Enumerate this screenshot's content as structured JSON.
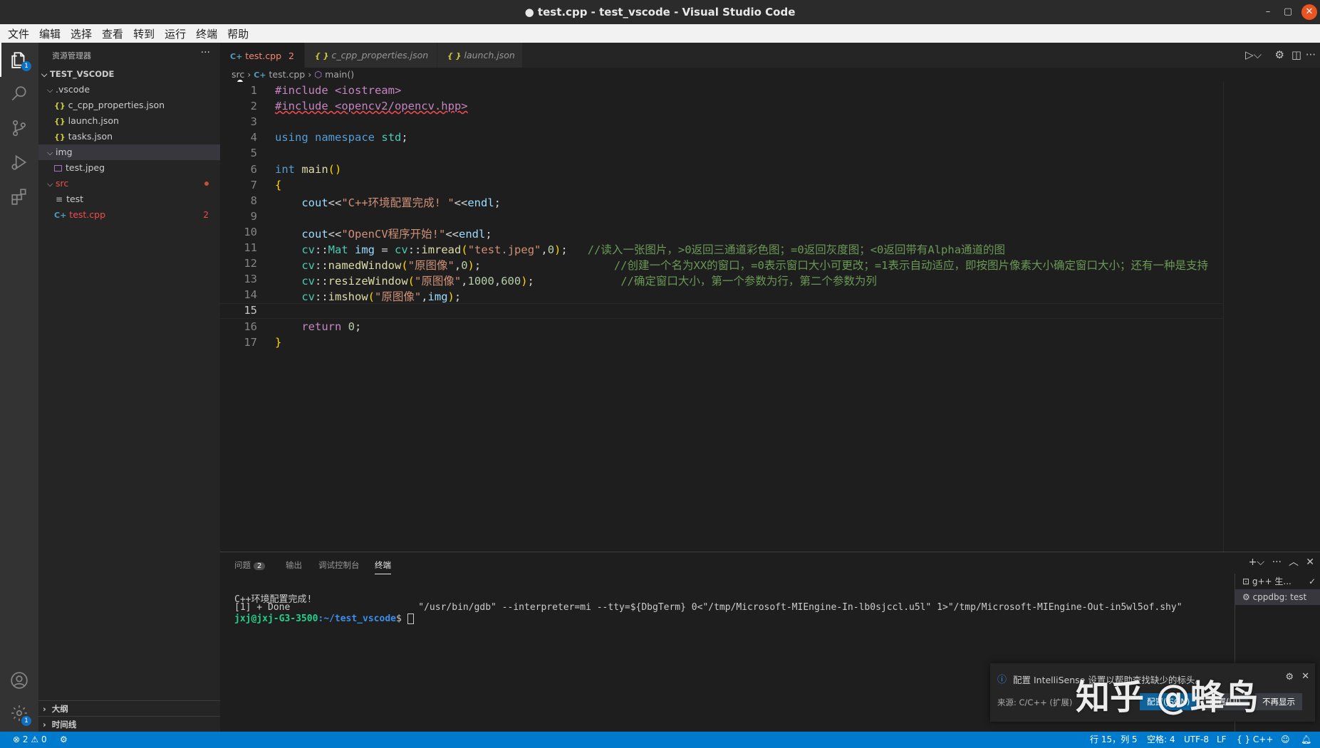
{
  "window": {
    "title": "● test.cpp - test_vscode - Visual Studio Code",
    "minimize": "–",
    "maximize": "▢",
    "close": "✕"
  },
  "menu": [
    "文件",
    "编辑",
    "选择",
    "查看",
    "转到",
    "运行",
    "终端",
    "帮助"
  ],
  "activity": {
    "explorer_badge": "1",
    "settings_badge": "1"
  },
  "sidebar": {
    "title": "资源管理器",
    "more": "···",
    "root": "TEST_VSCODE",
    "items": [
      {
        "label": ".vscode",
        "kind": "folder-open"
      },
      {
        "label": "c_cpp_properties.json",
        "kind": "json"
      },
      {
        "label": "launch.json",
        "kind": "json"
      },
      {
        "label": "tasks.json",
        "kind": "json"
      },
      {
        "label": "img",
        "kind": "folder-open"
      },
      {
        "label": "test.jpeg",
        "kind": "image"
      },
      {
        "label": "src",
        "kind": "folder-open"
      },
      {
        "label": "test",
        "kind": "file"
      },
      {
        "label": "test.cpp",
        "kind": "cpp",
        "count": "2"
      }
    ],
    "outline": "大纲",
    "timeline": "时间线"
  },
  "tabs": [
    {
      "icon": "C+",
      "label": "test.cpp",
      "count": "2"
    },
    {
      "icon": "{ }",
      "label": "c_cpp_properties.json"
    },
    {
      "icon": "{ }",
      "label": "launch.json"
    }
  ],
  "breadcrumb": {
    "folder": "src",
    "file": "test.cpp",
    "symbol": "main()"
  },
  "editor": {
    "current_line": 15,
    "line_count": 17
  },
  "panel": {
    "tabs": {
      "problems": "问题",
      "problems_count": "2",
      "output": "输出",
      "debug_console": "调试控制台",
      "terminal": "终端"
    },
    "terminal_lines": {
      "line1": "C++环境配置完成!",
      "line2": "[1] + Done                       \"/usr/bin/gdb\" --interpreter=mi --tty=${DbgTerm} 0<\"/tmp/Microsoft-MIEngine-In-lb0sjccl.u5l\" 1>\"/tmp/Microsoft-MIEngine-Out-in5wl5of.shy\"",
      "prompt_user": "jxj@jxj-G3-3500",
      "prompt_path": ":~/test_vscode",
      "prompt_suffix": "$ "
    },
    "terminals": [
      "g++ 生...",
      "cppdbg: test"
    ]
  },
  "notification": {
    "text": "配置 IntelliSense 设置以帮助查找缺少的标头。",
    "source": "来源: C/C++ (扩展)",
    "primary_button": "配置(JSON)",
    "secondary_button": "配置(UI)",
    "dismiss_button": "不再显示"
  },
  "watermark": "知乎 @蜂鸟",
  "statusbar": {
    "errors": "2",
    "warnings": "0",
    "position": "行 15，列 5",
    "spaces": "空格: 4",
    "encoding": "UTF-8",
    "eol": "LF",
    "language": "{ } C++"
  },
  "colors": {
    "statusbar": "#007acc",
    "accent": "#0e639c",
    "error": "#f14c4c"
  }
}
